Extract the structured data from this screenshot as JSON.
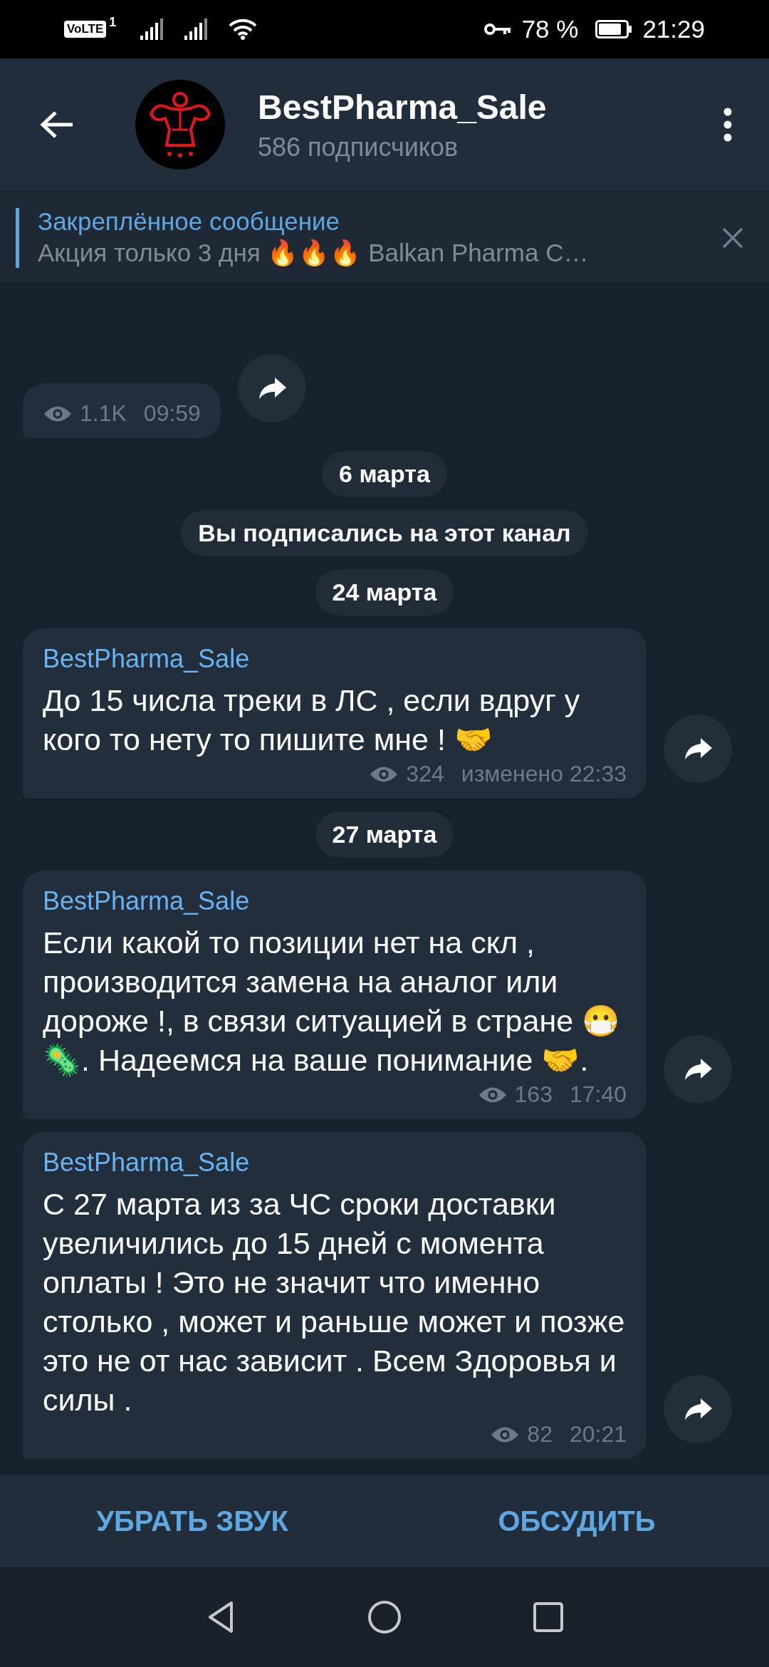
{
  "status_bar": {
    "volte": "VoLTE",
    "sim": "1",
    "battery": "78 %",
    "time": "21:29"
  },
  "header": {
    "title": "BestPharma_Sale",
    "subtitle": "586 подписчиков"
  },
  "pinned": {
    "title": "Закреплённое сообщение",
    "text": "Акция только 3 дня 🔥🔥🔥 Balkan Pharma C…"
  },
  "feed": [
    {
      "kind": "message",
      "views": "1.1K",
      "time": "09:59"
    },
    {
      "kind": "date",
      "text": "6 марта"
    },
    {
      "kind": "service",
      "text": "Вы подписались на этот канал"
    },
    {
      "kind": "date",
      "text": "24 марта"
    },
    {
      "kind": "message",
      "author": "BestPharma_Sale",
      "text": "До 15 числа треки в ЛС , если вдруг у кого то нету то пишите мне ! 🤝",
      "views": "324",
      "time": "изменено 22:33"
    },
    {
      "kind": "date",
      "text": "27 марта"
    },
    {
      "kind": "message",
      "author": "BestPharma_Sale",
      "text": "Если какой то позиции нет на скл , производится замена на аналог или дороже !, в связи ситуацией в стране 😷🦠. Надеемся на ваше понимание 🤝.",
      "views": "163",
      "time": "17:40"
    },
    {
      "kind": "message",
      "author": "BestPharma_Sale",
      "text": "С 27 марта из за ЧС сроки доставки увеличились до 15 дней с момента оплаты ! Это не значит что именно столько , может и раньше может и позже это не от нас зависит . Всем Здоровья и силы .",
      "views": "82",
      "time": "20:21"
    }
  ],
  "actions": [
    "УБРАТЬ ЗВУК",
    "ОБСУДИТЬ"
  ]
}
